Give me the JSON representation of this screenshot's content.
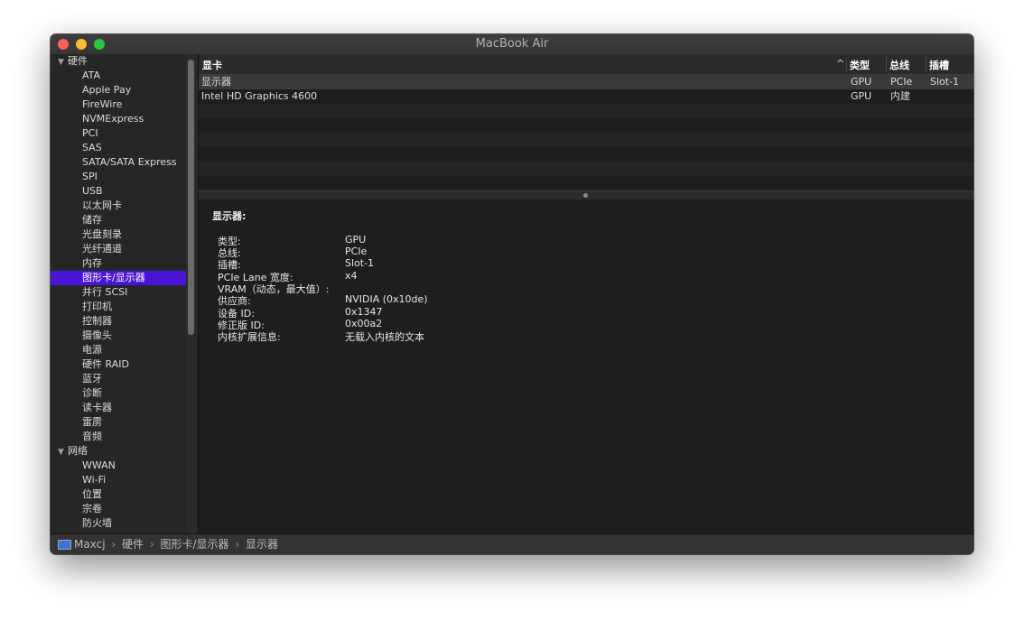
{
  "window": {
    "title": "MacBook Air"
  },
  "sidebar": {
    "groups": [
      {
        "label": "硬件",
        "items": [
          "ATA",
          "Apple Pay",
          "FireWire",
          "NVMExpress",
          "PCI",
          "SAS",
          "SATA/SATA Express",
          "SPI",
          "USB",
          "以太网卡",
          "储存",
          "光盘刻录",
          "光纤通道",
          "内存",
          "图形卡/显示器",
          "并行 SCSI",
          "打印机",
          "控制器",
          "摄像头",
          "电源",
          "硬件 RAID",
          "蓝牙",
          "诊断",
          "读卡器",
          "雷雳",
          "音频"
        ]
      },
      {
        "label": "网络",
        "items": [
          "WWAN",
          "Wi-Fi",
          "位置",
          "宗卷",
          "防火墙"
        ]
      }
    ],
    "selected": "图形卡/显示器"
  },
  "table": {
    "headers": {
      "name": "显卡",
      "type": "类型",
      "bus": "总线",
      "slot": "插槽"
    },
    "sort_indicator": "^",
    "rows": [
      {
        "name": "显示器",
        "type": "GPU",
        "bus": "PCIe",
        "slot": "Slot-1"
      },
      {
        "name": "Intel HD Graphics 4600",
        "type": "GPU",
        "bus": "内建",
        "slot": ""
      }
    ]
  },
  "detail": {
    "title": "显示器:",
    "fields": [
      {
        "key": "类型:",
        "value": "GPU"
      },
      {
        "key": "总线:",
        "value": "PCIe"
      },
      {
        "key": "插槽:",
        "value": "Slot-1"
      },
      {
        "key": "PCIe Lane 宽度:",
        "value": "x4"
      },
      {
        "key": "VRAM（动态，最大值）:",
        "value": ""
      },
      {
        "key": "供应商:",
        "value": "NVIDIA (0x10de)"
      },
      {
        "key": "设备 ID:",
        "value": "0x1347"
      },
      {
        "key": "修正版 ID:",
        "value": "0x00a2"
      },
      {
        "key": "内核扩展信息:",
        "value": "无载入内核的文本"
      }
    ]
  },
  "statusbar": {
    "breadcrumbs": [
      "Maxcj",
      "硬件",
      "图形卡/显示器",
      "显示器"
    ],
    "separator": "›"
  }
}
